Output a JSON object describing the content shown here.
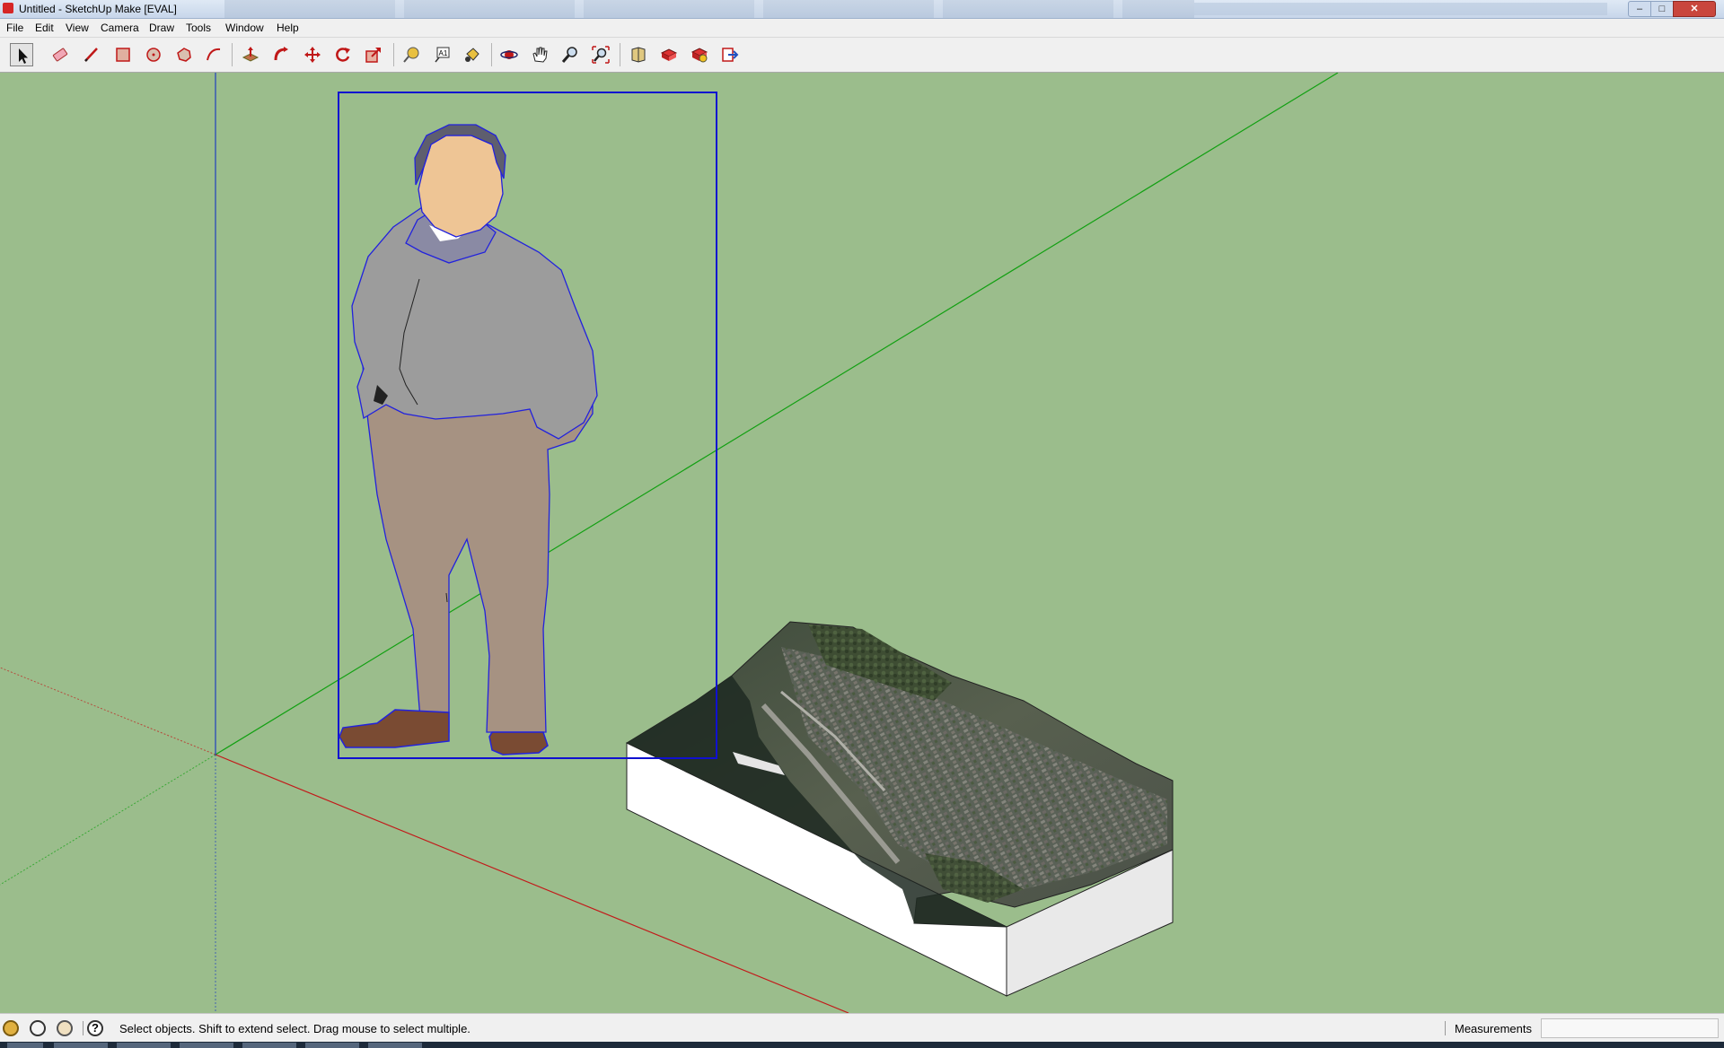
{
  "window": {
    "title": "Untitled - SketchUp Make [EVAL]",
    "controls": {
      "minimize": "–",
      "maximize": "□",
      "close": "✕"
    }
  },
  "menu": [
    "File",
    "Edit",
    "View",
    "Camera",
    "Draw",
    "Tools",
    "Window",
    "Help"
  ],
  "toolbar": {
    "tools": [
      {
        "name": "select-tool",
        "icon": "arrow-cursor-icon",
        "active": true
      },
      {
        "name": "eraser-tool",
        "icon": "eraser-icon"
      },
      {
        "name": "line-tool",
        "icon": "pencil-icon"
      },
      {
        "name": "rectangle-tool",
        "icon": "rectangle-icon"
      },
      {
        "name": "circle-tool",
        "icon": "circle-icon"
      },
      {
        "name": "polygon-tool",
        "icon": "polygon-icon"
      },
      {
        "name": "arc-tool",
        "icon": "arc-icon"
      },
      {
        "name": "push-pull-tool",
        "icon": "push-pull-icon"
      },
      {
        "name": "follow-me-tool",
        "icon": "follow-me-icon"
      },
      {
        "name": "move-tool",
        "icon": "move-icon"
      },
      {
        "name": "rotate-tool",
        "icon": "rotate-icon"
      },
      {
        "name": "scale-tool",
        "icon": "scale-icon"
      },
      {
        "name": "tape-measure-tool",
        "icon": "tape-measure-icon"
      },
      {
        "name": "text-tool",
        "icon": "text-icon"
      },
      {
        "name": "paint-bucket-tool",
        "icon": "paint-bucket-icon"
      },
      {
        "name": "orbit-tool",
        "icon": "orbit-icon"
      },
      {
        "name": "pan-tool",
        "icon": "hand-icon"
      },
      {
        "name": "zoom-tool",
        "icon": "magnifier-icon"
      },
      {
        "name": "zoom-extents-tool",
        "icon": "zoom-extents-icon"
      },
      {
        "name": "warehouse-tool",
        "icon": "3d-warehouse-icon"
      },
      {
        "name": "share-model-tool",
        "icon": "share-model-icon"
      },
      {
        "name": "extension-warehouse-tool",
        "icon": "extension-warehouse-icon"
      },
      {
        "name": "send-to-layout-tool",
        "icon": "send-to-layout-icon"
      }
    ],
    "text_tool_glyph": "A1"
  },
  "colors": {
    "viewport_bg": "#9bbd8c",
    "axis_red": "#c21a1a",
    "axis_green": "#12a012",
    "axis_blue": "#1f3fbf",
    "selection_blue": "#1010d0"
  },
  "statusbar": {
    "icons": [
      "geo-location-icon",
      "credits-icon",
      "user-icon",
      "help-icon"
    ],
    "help_glyph": "?",
    "message": "Select objects. Shift to extend select. Drag mouse to select multiple.",
    "measurements_label": "Measurements",
    "measurements_value": ""
  }
}
